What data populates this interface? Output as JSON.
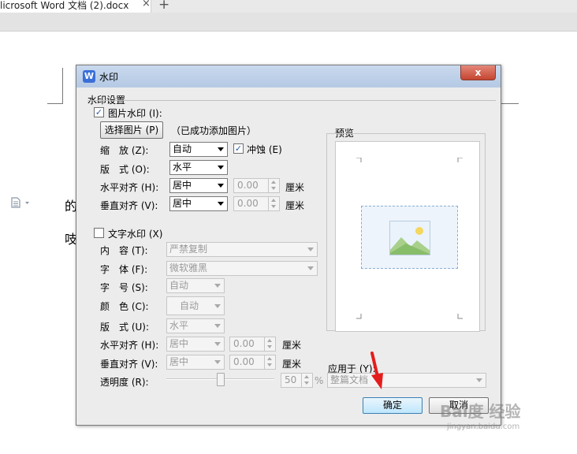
{
  "app": {
    "doc_tab_title": "licrosoft Word 文档 (2).docx",
    "tab_close": "×",
    "new_tab": "+",
    "doc_icon": "document-icon",
    "doc_text": [
      "的",
      "吱"
    ]
  },
  "dialog": {
    "title": "水印",
    "close_symbol": "x",
    "section_title": "水印设置",
    "picture": {
      "enable_label": "图片水印 (I):",
      "checked": true,
      "choose_button": "选择图片 (P)",
      "status": "（已成功添加图片）",
      "scale_label": "缩　放 (Z):",
      "scale_value": "自动",
      "washout_label": "冲蚀 (E)",
      "washout_checked": true,
      "layout_label": "版　式 (O):",
      "layout_value": "水平",
      "halign_label": "水平对齐 (H):",
      "halign_value": "居中",
      "halign_offset": "0.00",
      "valign_label": "垂直对齐 (V):",
      "valign_value": "居中",
      "valign_offset": "0.00",
      "unit": "厘米"
    },
    "text": {
      "enable_label": "文字水印 (X)",
      "checked": false,
      "content_label": "内　容 (T):",
      "content_value": "严禁复制",
      "font_label": "字　体 (F):",
      "font_value": "微软雅黑",
      "size_label": "字　号 (S):",
      "size_value": "自动",
      "color_label": "颜　色 (C):",
      "color_value": "自动",
      "layout_label": "版　式 (U):",
      "layout_value": "水平",
      "halign_label": "水平对齐 (H):",
      "halign_value": "居中",
      "halign_offset": "0.00",
      "valign_label": "垂直对齐 (V):",
      "valign_value": "居中",
      "valign_offset": "0.00",
      "unit": "厘米",
      "transparency_label": "透明度 (R):",
      "transparency_value": "50",
      "transparency_unit": "%"
    },
    "preview_label": "预览",
    "apply_label": "应用于 (Y):",
    "apply_value": "整篇文档",
    "ok_button": "确定",
    "cancel_button": "取消"
  },
  "watermark": "Bai度 经验",
  "watermark_url": "jingyan.baidu.com"
}
